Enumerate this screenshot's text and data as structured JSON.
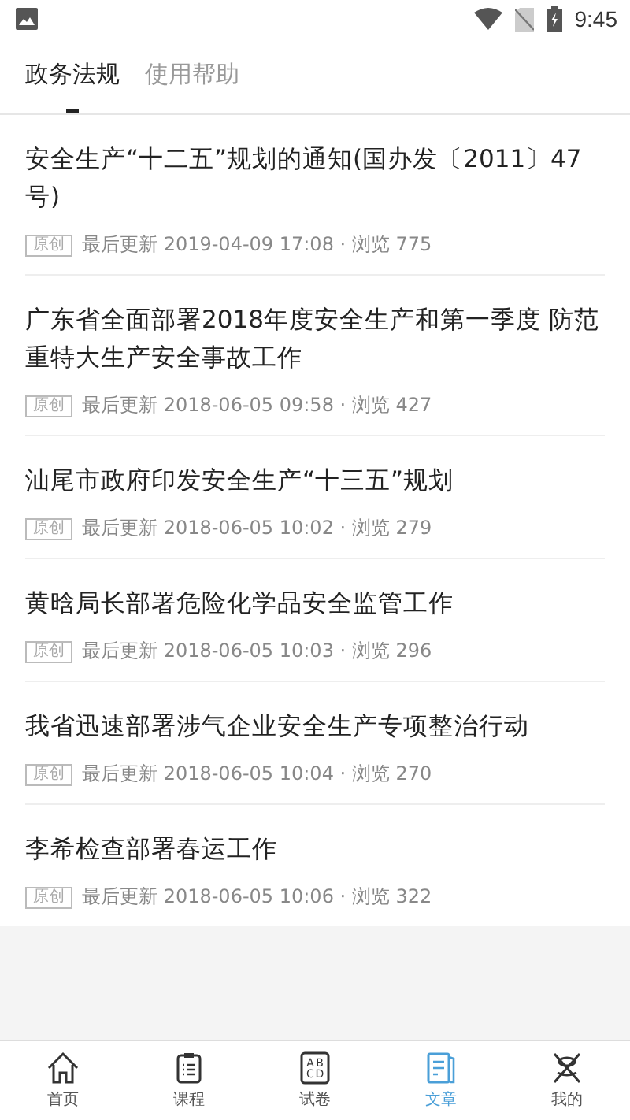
{
  "status_bar": {
    "time": "9:45"
  },
  "tabs": [
    {
      "label": "政务法规",
      "selected": true
    },
    {
      "label": "使用帮助",
      "selected": false
    }
  ],
  "articles": [
    {
      "title": "安全生产“十二五”规划的通知(国办发〔2011〕47号)",
      "tag": "原创",
      "meta": "最后更新 2019-04-09 17:08 · 浏览 775"
    },
    {
      "title": "广东省全面部署2018年度安全生产和第一季度 防范重特大生产安全事故工作",
      "tag": "原创",
      "meta": "最后更新 2018-06-05 09:58 · 浏览 427"
    },
    {
      "title": "汕尾市政府印发安全生产“十三五”规划",
      "tag": "原创",
      "meta": "最后更新 2018-06-05 10:02 · 浏览 279"
    },
    {
      "title": "黄晗局长部署危险化学品安全监管工作",
      "tag": "原创",
      "meta": "最后更新 2018-06-05 10:03 · 浏览 296"
    },
    {
      "title": "我省迅速部署涉气企业安全生产专项整治行动",
      "tag": "原创",
      "meta": "最后更新 2018-06-05 10:04 · 浏览 270"
    },
    {
      "title": "李希检查部署春运工作",
      "tag": "原创",
      "meta": "最后更新 2018-06-05 10:06 · 浏览 322"
    }
  ],
  "bottom_nav": [
    {
      "kind": "home",
      "label": "首页",
      "selected": false
    },
    {
      "kind": "course",
      "label": "课程",
      "selected": false
    },
    {
      "kind": "exam",
      "label": "试卷",
      "selected": false,
      "glyphs": [
        "A",
        "B",
        "C",
        "D"
      ]
    },
    {
      "kind": "article",
      "label": "文章",
      "selected": true
    },
    {
      "kind": "profile",
      "label": "我的",
      "selected": false
    }
  ]
}
